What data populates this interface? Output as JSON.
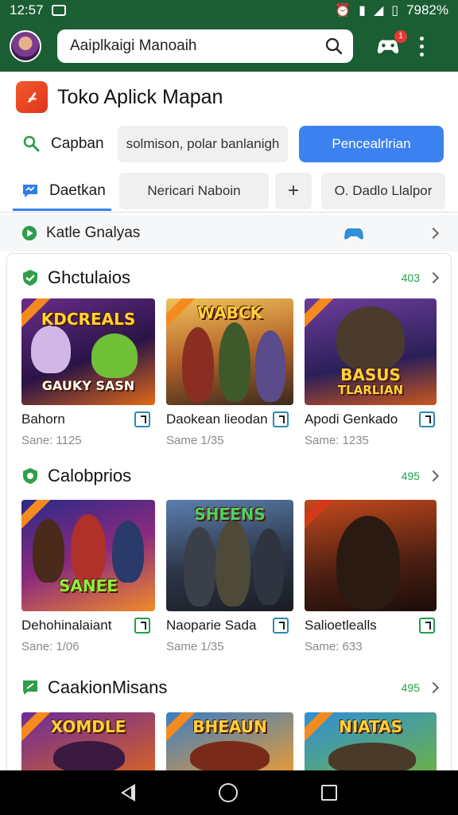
{
  "status": {
    "time": "12:57",
    "battery": "7982%"
  },
  "search": {
    "value": "Aaiplkaigi Manoaih"
  },
  "notifications": {
    "count": "1"
  },
  "header": {
    "title": "Toko Aplick Mapan"
  },
  "row1": {
    "label": "Capban",
    "field": "solmison, polar banlanigh",
    "button": "Pencealrlrian"
  },
  "row2": {
    "label": "Daetkan",
    "field": "Nericari Naboin",
    "plus": "+",
    "field2": "O. Dadlo Llalpor"
  },
  "kategori": {
    "label": "Katle Gnalyas"
  },
  "sections": [
    {
      "title": "Ghctulaios",
      "count": "403",
      "items": [
        {
          "thumb_title": "KDCREALS",
          "thumb_sub": "GAUKY SASN",
          "name": "Bahorn",
          "sub": "Sane: 1125"
        },
        {
          "thumb_title": "WABCK",
          "thumb_sub": "",
          "name": "Daokean lieodan",
          "sub": "Same 1/35"
        },
        {
          "thumb_title": "BASUS",
          "thumb_sub": "TLARLIAN",
          "name": "Apodi Genkado",
          "sub": "Same: 1235"
        }
      ]
    },
    {
      "title": "Calobprios",
      "count": "495",
      "items": [
        {
          "thumb_title": "SANEE",
          "thumb_sub": "",
          "name": "Dehohinalaiant",
          "sub": "Sane: 1/06"
        },
        {
          "thumb_title": "SHEENS",
          "thumb_sub": "",
          "name": "Naoparie Sada",
          "sub": "Same 1/35"
        },
        {
          "thumb_title": "",
          "thumb_sub": "",
          "name": "Salioetlealls",
          "sub": "Same: 633"
        }
      ]
    },
    {
      "title": "CaakionMisans",
      "count": "495",
      "items": [
        {
          "thumb_title": "XOMDLE",
          "thumb_sub": "",
          "name": "",
          "sub": ""
        },
        {
          "thumb_title": "BHEAUN",
          "thumb_sub": "",
          "name": "",
          "sub": ""
        },
        {
          "thumb_title": "NIATAS",
          "thumb_sub": "",
          "name": "",
          "sub": ""
        }
      ]
    }
  ],
  "colors": {
    "appbar": "#1b5e34",
    "accent_blue": "#3b82f0",
    "count_green": "#22a04b"
  }
}
